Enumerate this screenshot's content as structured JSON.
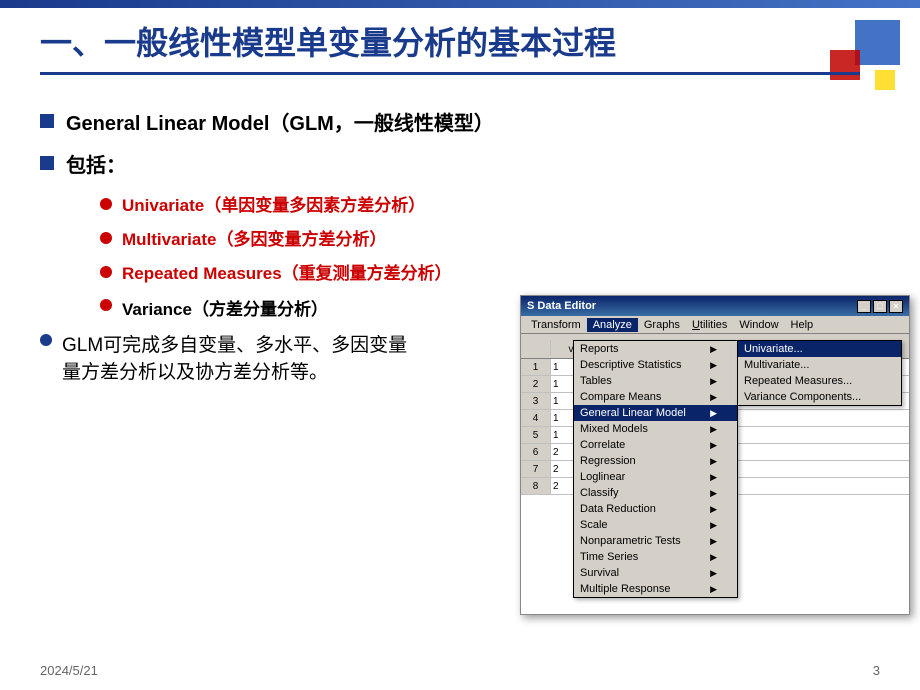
{
  "slide": {
    "title": "一、一般线性模型单变量分析的基本过程",
    "footer": {
      "date": "2024/5/21",
      "page": "3"
    }
  },
  "content": {
    "bullet1": {
      "text": "General Linear Model（GLM，一般线性模型）"
    },
    "bullet2": {
      "text": "包括："
    },
    "sub_bullets": [
      {
        "text": "Univariate（单因变量多因素方差分析）",
        "colored": true
      },
      {
        "text": "Multivariate（多因变量方差分析）",
        "colored": true
      },
      {
        "text": "Repeated Measures（重复测量方差分析）",
        "colored": true
      },
      {
        "text": "Variance（方差分量分析）",
        "colored": false
      }
    ],
    "bullet3": {
      "text": "GLM可完成多自变量、多水平、多因变量方差分析以及协方差分析等。"
    }
  },
  "spss": {
    "titlebar": "S Data Editor",
    "titlebar_buttons": [
      "_",
      "□",
      "×"
    ],
    "menubar": [
      "Transform",
      "Analyze",
      "Graphs",
      "Utilities",
      "Window",
      "Help"
    ],
    "analyze_menu": {
      "items": [
        {
          "label": "Reports",
          "has_arrow": true
        },
        {
          "label": "Descriptive Statistics",
          "has_arrow": true
        },
        {
          "label": "Tables",
          "has_arrow": true
        },
        {
          "label": "Compare Means",
          "has_arrow": true
        },
        {
          "label": "General Linear Model",
          "has_arrow": true,
          "selected": true
        },
        {
          "label": "Mixed Models",
          "has_arrow": true
        },
        {
          "label": "Correlate",
          "has_arrow": true
        },
        {
          "label": "Regression",
          "has_arrow": true
        },
        {
          "label": "Loglinear",
          "has_arrow": true
        },
        {
          "label": "Classify",
          "has_arrow": true
        },
        {
          "label": "Data Reduction",
          "has_arrow": true
        },
        {
          "label": "Scale",
          "has_arrow": true
        },
        {
          "label": "Nonparametric Tests",
          "has_arrow": true
        },
        {
          "label": "Time Series",
          "has_arrow": true
        },
        {
          "label": "Survival",
          "has_arrow": true
        },
        {
          "label": "Multiple Response",
          "has_arrow": true
        }
      ]
    },
    "glm_submenu": {
      "items": [
        {
          "label": "Univariate...",
          "active": true
        },
        {
          "label": "Multivariate..."
        },
        {
          "label": "Repeated Measures..."
        },
        {
          "label": "Variance Components..."
        }
      ]
    },
    "grid_rows": [
      "1",
      "1",
      "1",
      "1",
      "1",
      "2",
      "2",
      "2"
    ]
  }
}
